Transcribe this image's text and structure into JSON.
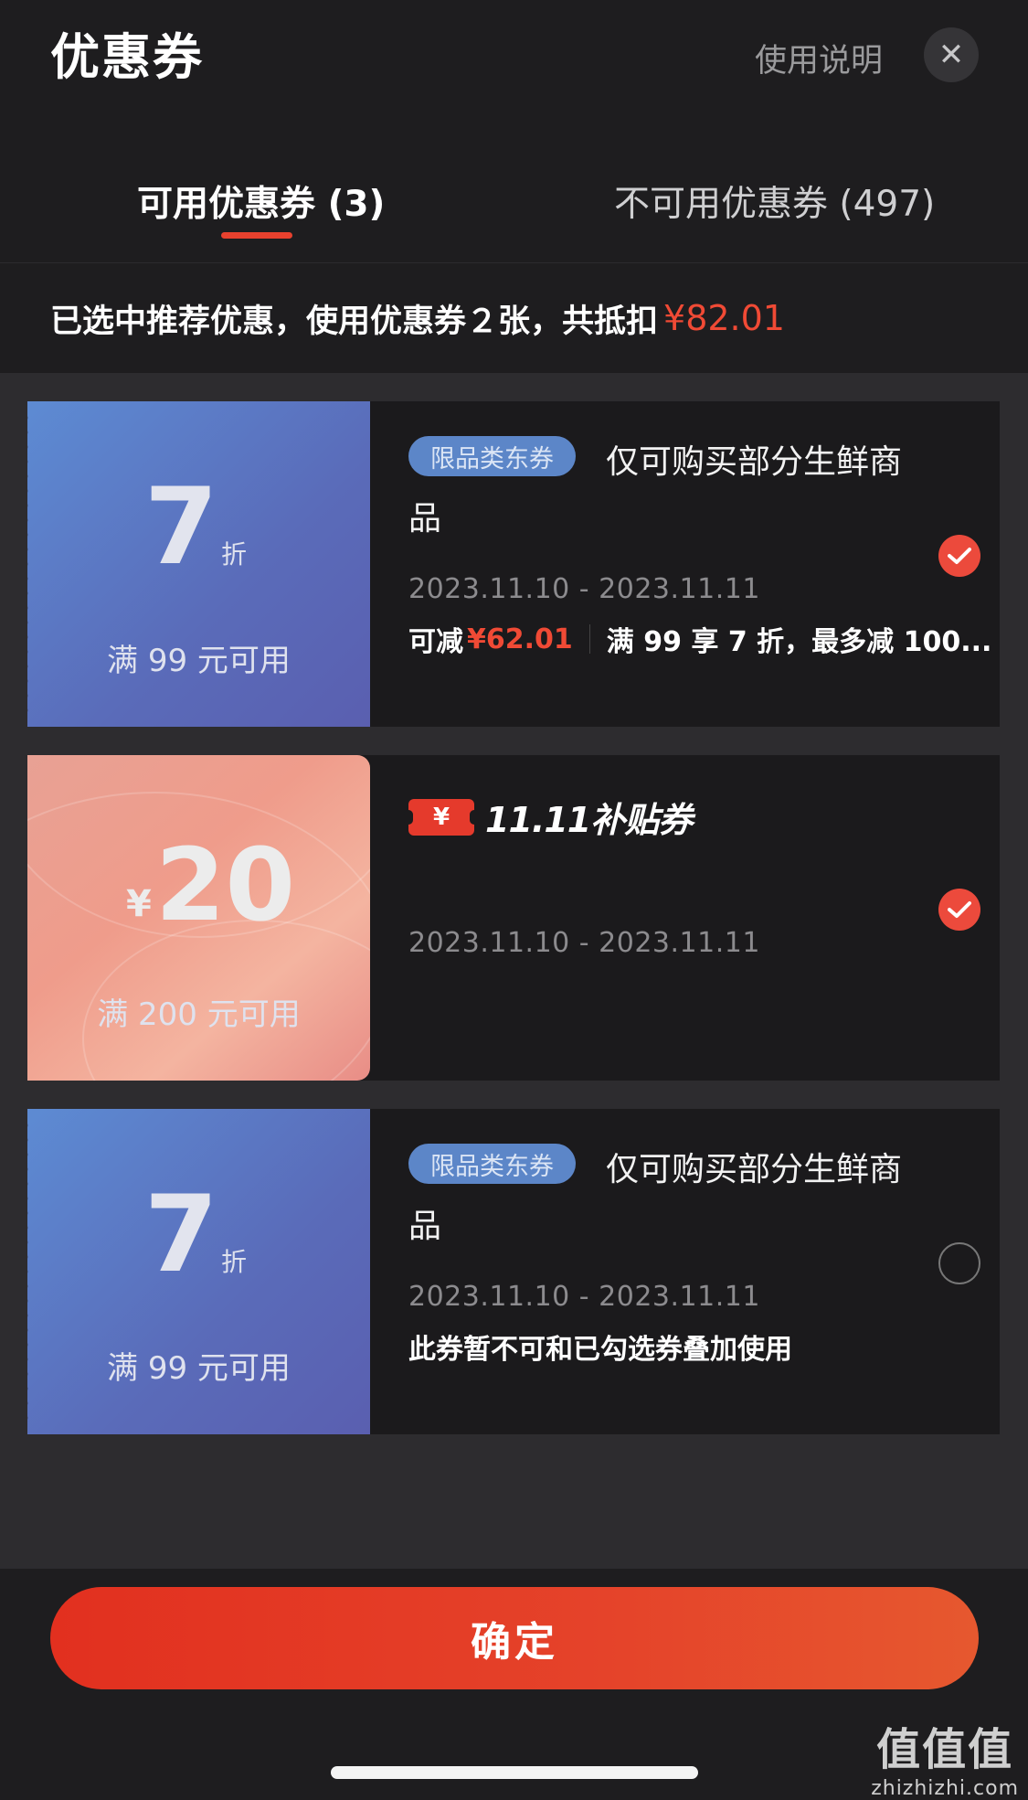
{
  "header": {
    "title": "优惠券",
    "help_label": "使用说明",
    "close_glyph": "✕"
  },
  "tabs": [
    {
      "label": "可用优惠券 (3)",
      "active": true
    },
    {
      "label": "不可用优惠券 (497)",
      "active": false
    }
  ],
  "summary": {
    "text": "已选中推荐优惠，使用优惠券２张，共抵扣",
    "amount": "¥82.01"
  },
  "coupons": [
    {
      "value": "7",
      "unit": "折",
      "condition": "满 99 元可用",
      "tag": "限品类东券",
      "description": "仅可购买部分生鲜商品",
      "dates": "2023.11.10 - 2023.11.11",
      "deduct_label": "可减",
      "deduct_amount": "¥62.01",
      "rule": "满 99 享 7 折，最多减 100...",
      "selected": true
    },
    {
      "currency": "¥",
      "value": "20",
      "condition": "满 200 元可用",
      "brand_ticket": "¥",
      "brand_text": "11.11补贴券",
      "dates": "2023.11.10 - 2023.11.11",
      "selected": true
    },
    {
      "value": "7",
      "unit": "折",
      "condition": "满 99 元可用",
      "tag": "限品类东券",
      "description": "仅可购买部分生鲜商品",
      "dates": "2023.11.10 - 2023.11.11",
      "note": "此券暂不可和已勾选券叠加使用",
      "selected": false
    }
  ],
  "footer": {
    "confirm_label": "确定"
  },
  "watermark": {
    "main": "值值值",
    "sub": "zhizhizhi.com"
  },
  "colors": {
    "accent": "#e8412e",
    "background": "#1e1d1f",
    "list_bg": "#2d2c2f",
    "tag_blue": "#5c86c8"
  }
}
